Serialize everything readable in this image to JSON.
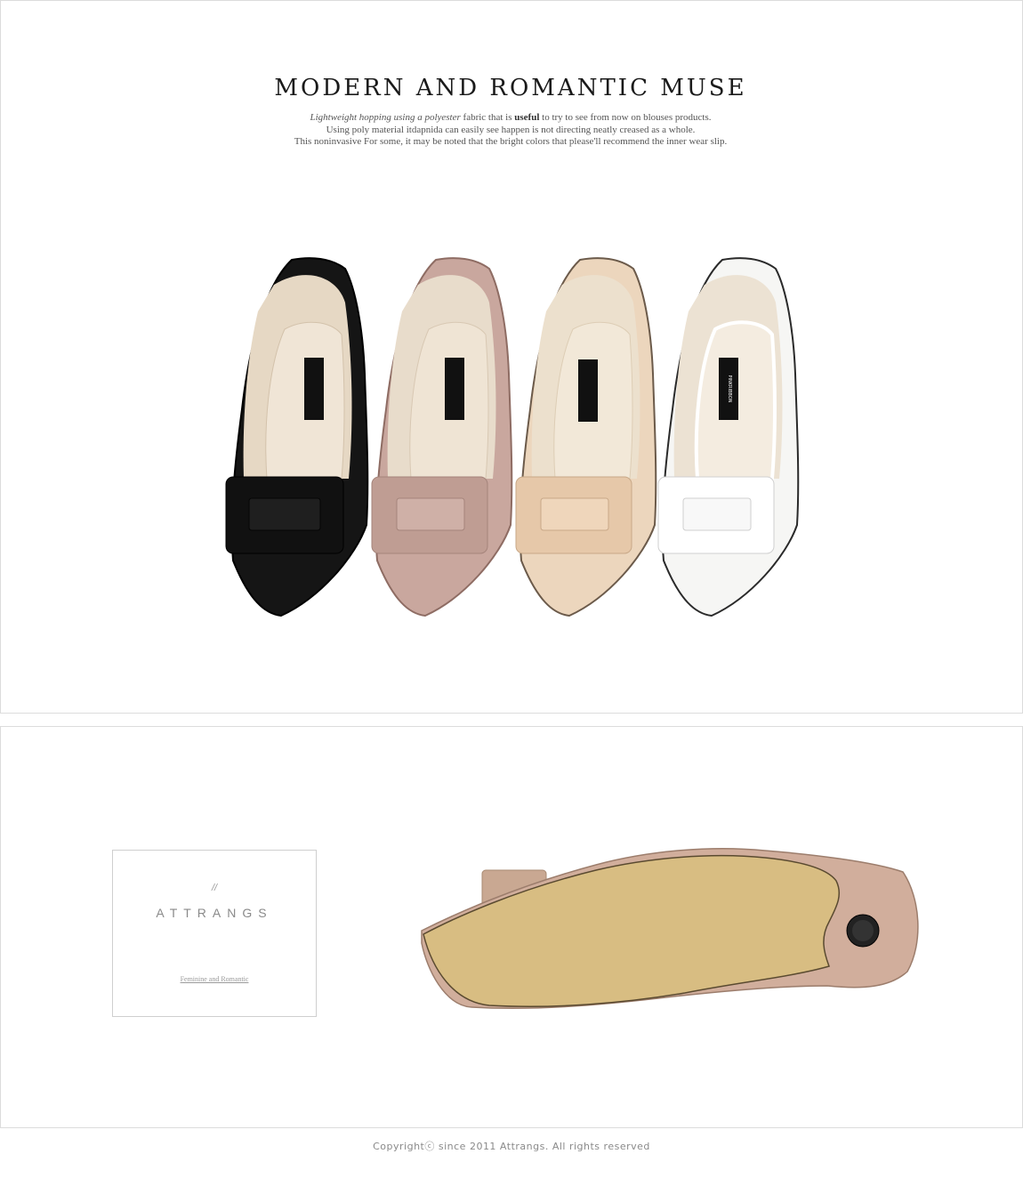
{
  "hero": {
    "title": "MODERN AND ROMANTIC MUSE",
    "description": {
      "line1_italic": "Lightweight hopping using a polyester",
      "line1_pre": " fabric that is ",
      "line1_bold": "useful",
      "line1_post": " to try to see from now on blouses products.",
      "line2": "Using poly material itdapnida can easily see happen is not directing neatly creased as a whole.",
      "line3": "This noninvasive For some, it may be noted that the bright colors that please'll recommend the inner wear slip."
    },
    "insole_label": "PINKRIBBON",
    "shoe_colors": [
      "#151515",
      "#c9a79e",
      "#ecd6bd",
      "#f6f6f4"
    ]
  },
  "brand": {
    "slash": "//",
    "name": "ATTRANGS",
    "tagline": "Feminine and Romantic"
  },
  "sole_view": {
    "upper_color": "#d1ae9c",
    "sole_color": "#d8bd82"
  },
  "footer": {
    "copyright": "Copyrightⓒ  since 2011 Attrangs. All rights reserved"
  }
}
